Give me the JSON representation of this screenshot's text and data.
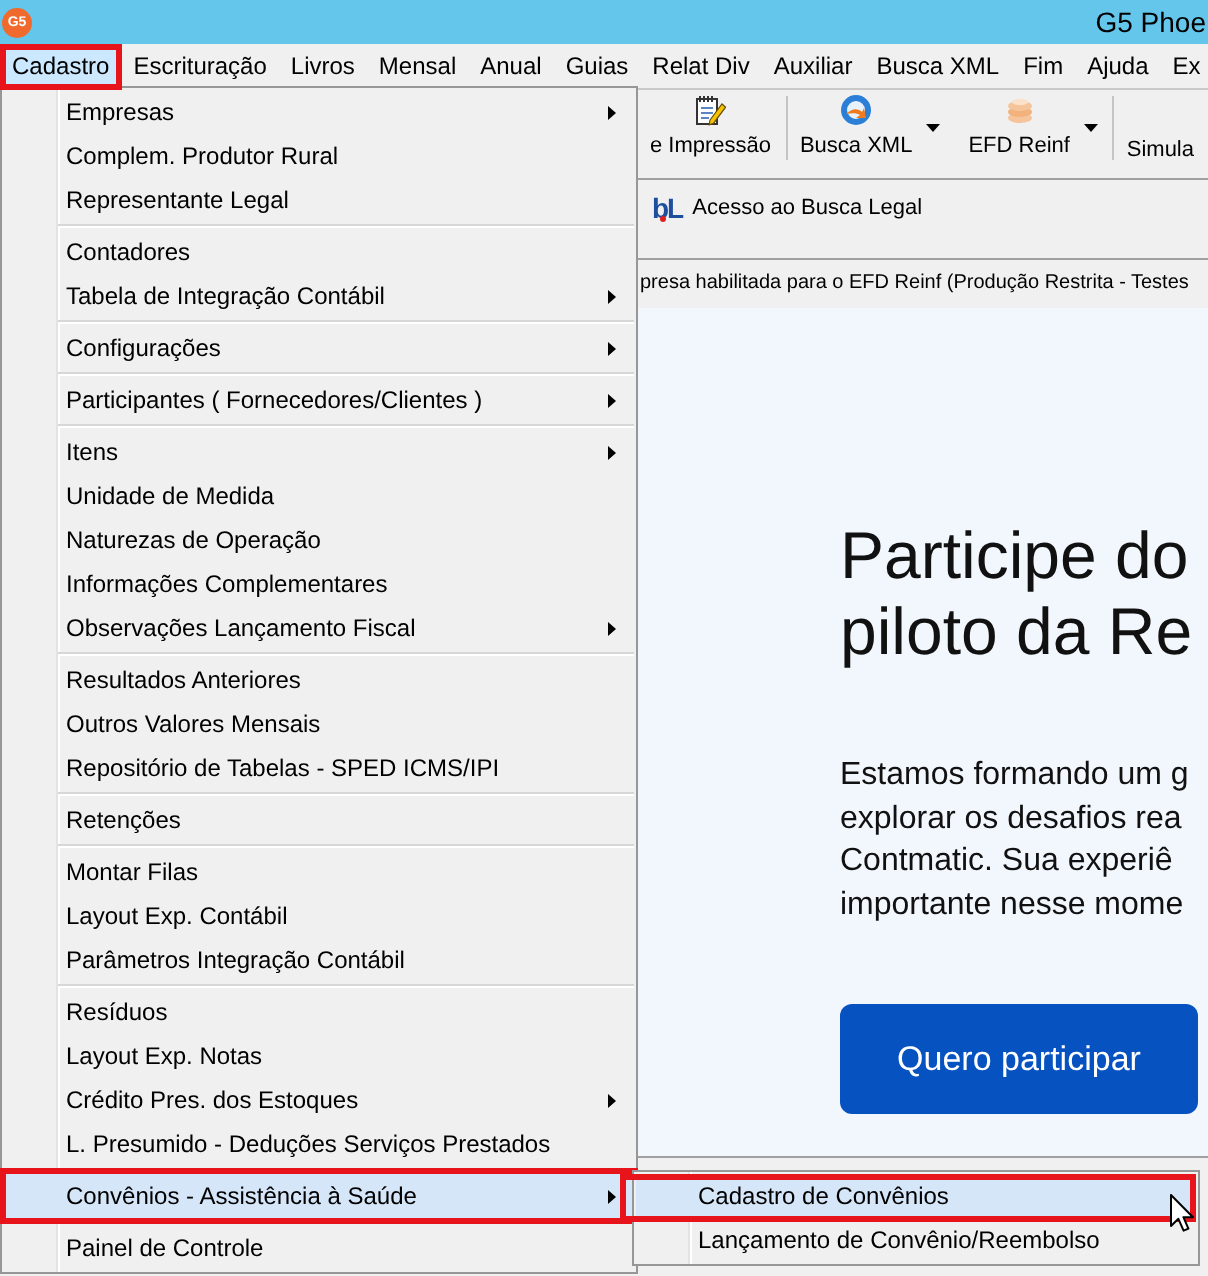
{
  "window": {
    "icon_label": "G5",
    "title": "G5 Phoe"
  },
  "menu_bar": [
    {
      "label": "Cadastro",
      "selected": true,
      "annotated": true
    },
    {
      "label": "Escrituração",
      "selected": false,
      "annotated": false
    },
    {
      "label": "Livros",
      "selected": false,
      "annotated": false
    },
    {
      "label": "Mensal",
      "selected": false,
      "annotated": false
    },
    {
      "label": "Anual",
      "selected": false,
      "annotated": false
    },
    {
      "label": "Guias",
      "selected": false,
      "annotated": false
    },
    {
      "label": "Relat Div",
      "selected": false,
      "annotated": false
    },
    {
      "label": "Auxiliar",
      "selected": false,
      "annotated": false
    },
    {
      "label": "Busca XML",
      "selected": false,
      "annotated": false
    },
    {
      "label": "Fim",
      "selected": false,
      "annotated": false
    },
    {
      "label": "Ajuda",
      "selected": false,
      "annotated": false
    },
    {
      "label": "Ex",
      "selected": false,
      "annotated": false
    }
  ],
  "toolbar": {
    "groups": [
      {
        "buttons": [
          {
            "label": "e Impressão",
            "dropdown": false
          }
        ]
      },
      {
        "buttons": [
          {
            "label": "Busca XML",
            "dropdown": true
          },
          {
            "label": "EFD Reinf",
            "dropdown": true
          }
        ]
      },
      {
        "buttons": [
          {
            "label": "Simula",
            "dropdown": false
          }
        ]
      }
    ]
  },
  "busca_legal": {
    "logo_text": "bL",
    "label": "Acesso ao Busca Legal"
  },
  "notice": "presa habilitada para o EFD Reinf (Produção Restrita - Testes",
  "promo": {
    "heading_lines": [
      "Participe do",
      "piloto da Re"
    ],
    "paragraph_lines": [
      "Estamos formando um g",
      "explorar os desafios rea",
      "Contmatic. Sua experiê",
      "importante nesse mome"
    ],
    "button": "Quero participar"
  },
  "dropdown_menu": {
    "groups": [
      {
        "items": [
          {
            "label": "Empresas",
            "submenu": true,
            "selected": false,
            "annotated": false
          },
          {
            "label": "Complem. Produtor Rural",
            "submenu": false,
            "selected": false,
            "annotated": false
          },
          {
            "label": "Representante Legal",
            "submenu": false,
            "selected": false,
            "annotated": false
          }
        ]
      },
      {
        "items": [
          {
            "label": "Contadores",
            "submenu": false,
            "selected": false,
            "annotated": false
          },
          {
            "label": "Tabela de Integração Contábil",
            "submenu": true,
            "selected": false,
            "annotated": false
          }
        ]
      },
      {
        "items": [
          {
            "label": "Configurações",
            "submenu": true,
            "selected": false,
            "annotated": false
          }
        ]
      },
      {
        "items": [
          {
            "label": "Participantes ( Fornecedores/Clientes )",
            "submenu": true,
            "selected": false,
            "annotated": false
          }
        ]
      },
      {
        "items": [
          {
            "label": "Itens",
            "submenu": true,
            "selected": false,
            "annotated": false
          },
          {
            "label": "Unidade de Medida",
            "submenu": false,
            "selected": false,
            "annotated": false
          },
          {
            "label": "Naturezas de Operação",
            "submenu": false,
            "selected": false,
            "annotated": false
          },
          {
            "label": "Informações Complementares",
            "submenu": false,
            "selected": false,
            "annotated": false
          },
          {
            "label": "Observações Lançamento Fiscal",
            "submenu": true,
            "selected": false,
            "annotated": false
          }
        ]
      },
      {
        "items": [
          {
            "label": "Resultados Anteriores",
            "submenu": false,
            "selected": false,
            "annotated": false
          },
          {
            "label": "Outros Valores Mensais",
            "submenu": false,
            "selected": false,
            "annotated": false
          },
          {
            "label": "Repositório de Tabelas - SPED ICMS/IPI",
            "submenu": false,
            "selected": false,
            "annotated": false
          }
        ]
      },
      {
        "items": [
          {
            "label": "Retenções",
            "submenu": false,
            "selected": false,
            "annotated": false
          }
        ]
      },
      {
        "items": [
          {
            "label": "Montar Filas",
            "submenu": false,
            "selected": false,
            "annotated": false
          },
          {
            "label": "Layout Exp. Contábil",
            "submenu": false,
            "selected": false,
            "annotated": false
          },
          {
            "label": "Parâmetros Integração Contábil",
            "submenu": false,
            "selected": false,
            "annotated": false
          }
        ]
      },
      {
        "items": [
          {
            "label": "Resíduos",
            "submenu": false,
            "selected": false,
            "annotated": false
          },
          {
            "label": "Layout Exp. Notas",
            "submenu": false,
            "selected": false,
            "annotated": false
          },
          {
            "label": "Crédito Pres. dos Estoques",
            "submenu": true,
            "selected": false,
            "annotated": false
          },
          {
            "label": "L. Presumido - Deduções Serviços Prestados",
            "submenu": false,
            "selected": false,
            "annotated": false
          }
        ]
      },
      {
        "items": [
          {
            "label": "Convênios - Assistência à Saúde",
            "submenu": true,
            "selected": true,
            "annotated": true
          }
        ]
      },
      {
        "items": [
          {
            "label": "Painel de Controle",
            "submenu": false,
            "selected": false,
            "annotated": false
          }
        ]
      }
    ]
  },
  "submenu": {
    "items": [
      {
        "label": "Cadastro de Convênios",
        "selected": true,
        "annotated": true
      },
      {
        "label": "Lançamento de Convênio/Reembolso",
        "selected": false,
        "annotated": false
      }
    ]
  }
}
